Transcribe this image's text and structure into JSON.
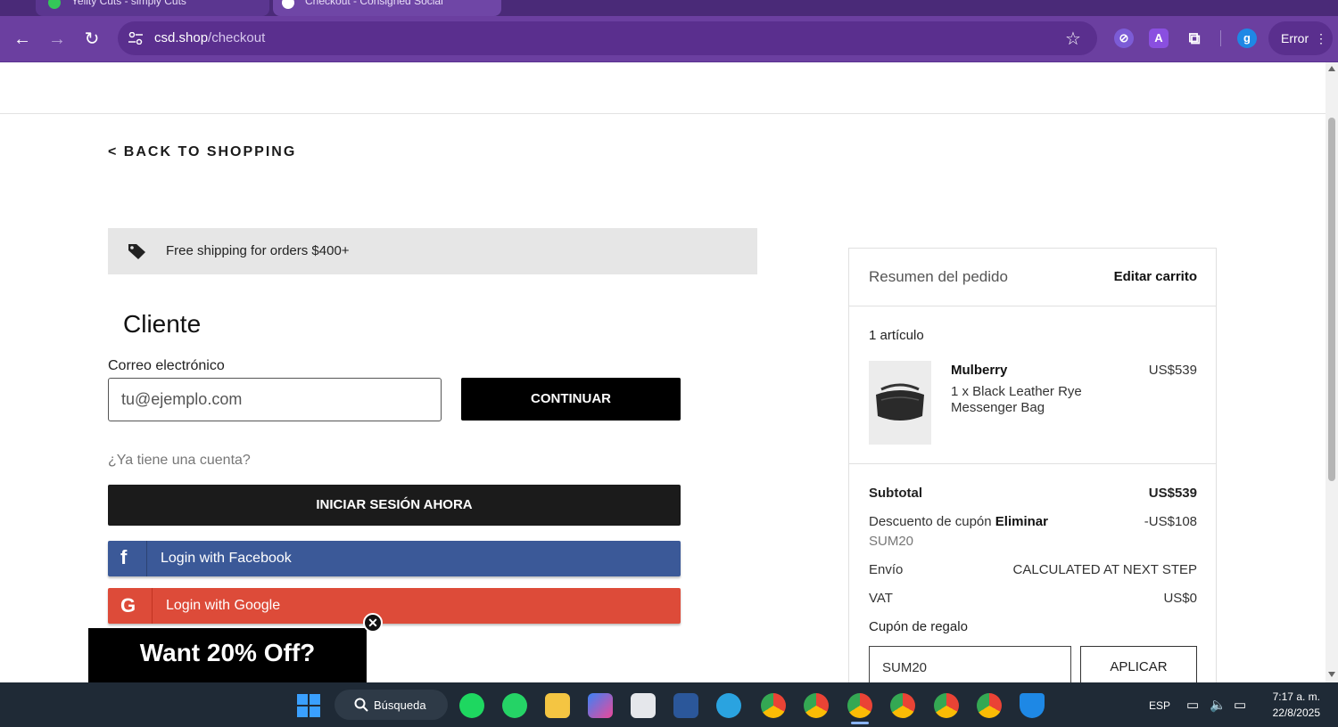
{
  "browser": {
    "tabs": [
      {
        "label": "Yellty Cuts - simply Cuts"
      },
      {
        "label": "Checkout - Consigned Social"
      }
    ],
    "url_domain": "csd.shop",
    "url_path": "/checkout",
    "error_label": "Error",
    "profile_initial": "g",
    "ext_a_label": "A"
  },
  "page": {
    "back_link": "< BACK TO SHOPPING",
    "shipping_banner": "Free shipping for orders $400+",
    "customer_title": "Cliente",
    "email_label": "Correo electrónico",
    "email_placeholder": "tu@ejemplo.com",
    "continue_label": "CONTINUAR",
    "has_account": "¿Ya tiene una cuenta?",
    "login_now_label": "INICIAR SESIÓN AHORA",
    "facebook_label": "Login with Facebook",
    "facebook_glyph": "f",
    "google_label": "Login with Google",
    "google_glyph": "G",
    "promo_text": "Want 20% Off?",
    "promo_close": "✕"
  },
  "summary": {
    "title": "Resumen del pedido",
    "edit_cart": "Editar carrito",
    "item_count": "1 artículo",
    "product": {
      "brand": "Mulberry",
      "name": "1 x Black Leather Rye Messenger Bag",
      "price": "US$539"
    },
    "subtotal_label": "Subtotal",
    "subtotal_value": "US$539",
    "discount_label": "Descuento de cupón",
    "discount_remove": "Eliminar",
    "discount_value": "-US$108",
    "coupon_code": "SUM20",
    "shipping_label": "Envío",
    "shipping_value": "CALCULATED AT NEXT STEP",
    "vat_label": "VAT",
    "vat_value": "US$0",
    "gift_label": "Cupón de regalo",
    "gift_input_value": "SUM20",
    "apply_label": "APLICAR"
  },
  "taskbar": {
    "search_label": "Búsqueda",
    "lang": "ESP",
    "time": "7:17 a. m.",
    "date": "22/8/2025"
  },
  "colors": {
    "browser_purple": "#6b3fa0",
    "facebook_blue": "#3b5998",
    "google_red": "#dd4b39",
    "button_black": "#000000"
  }
}
